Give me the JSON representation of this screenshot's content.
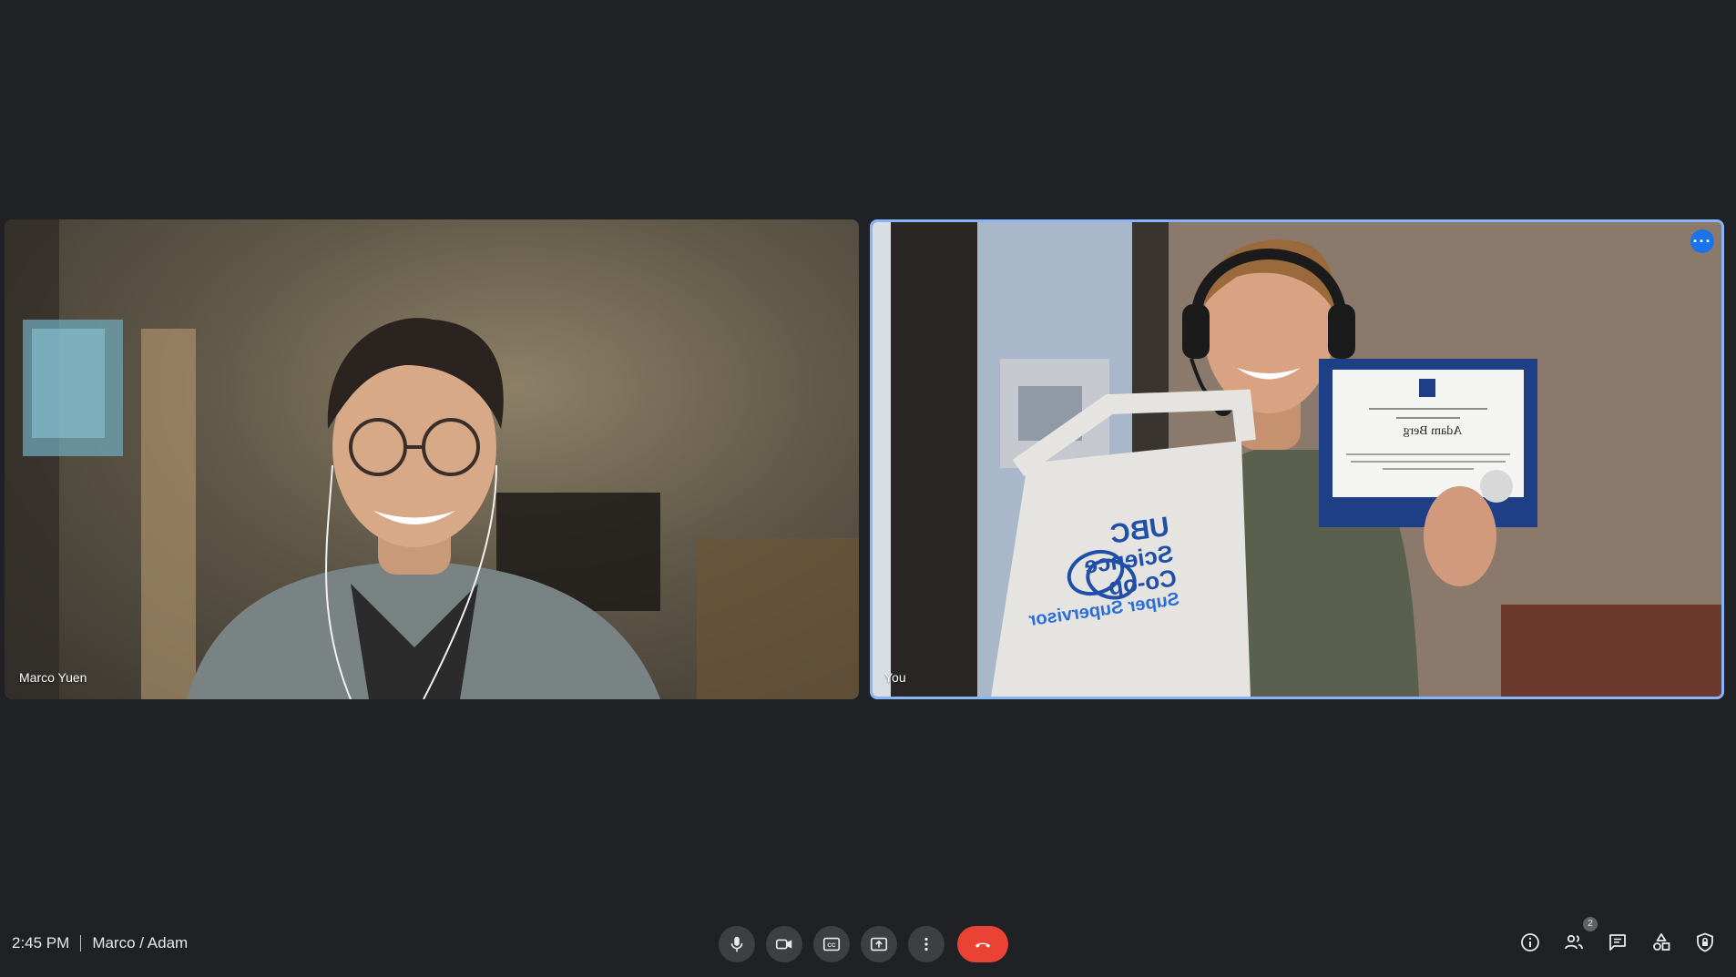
{
  "participants": [
    {
      "name": "Marco Yuen"
    },
    {
      "name": "You"
    }
  ],
  "certificate": {
    "recipient": "Adam Berg"
  },
  "bag": {
    "line1": "UBC",
    "line2": "Science",
    "line3": "Co-op",
    "line4": "Super Supervisor"
  },
  "meeting": {
    "time": "2:45 PM",
    "title": "Marco / Adam"
  },
  "people_count": "2",
  "icons": {
    "mic": "mic-icon",
    "camera": "videocam-icon",
    "captions": "closed-caption-icon",
    "present": "present-screen-icon",
    "more": "more-vert-icon",
    "hangup": "call-end-icon",
    "info": "info-icon",
    "people": "people-icon",
    "chat": "chat-icon",
    "activities": "activities-icon",
    "host": "host-controls-icon"
  },
  "colors": {
    "background": "#202124",
    "active_border": "#8ab4f8",
    "end_call": "#ea4335",
    "control_bg": "#3c4043"
  }
}
